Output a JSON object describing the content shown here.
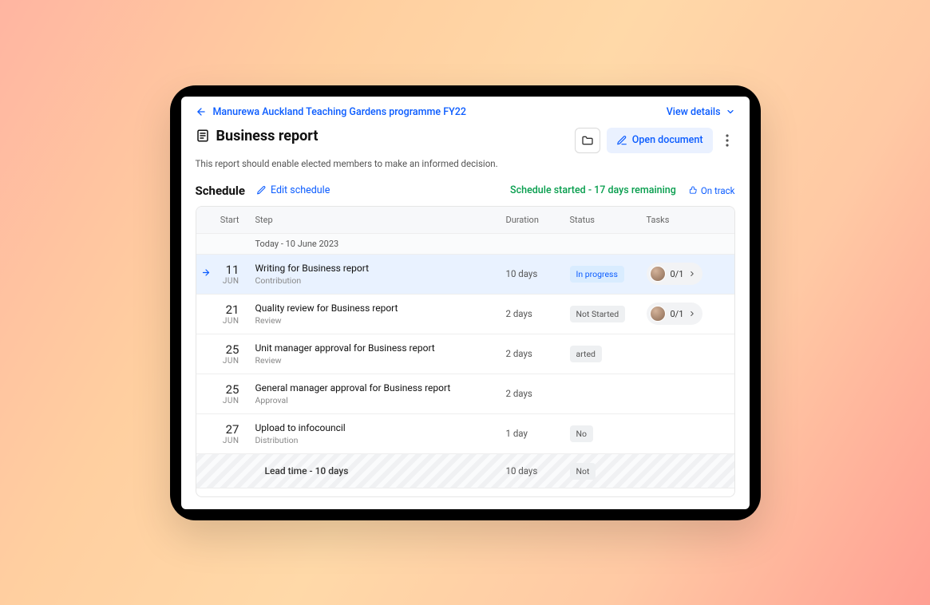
{
  "header": {
    "breadcrumb": "Manurewa Auckland Teaching Gardens programme FY22",
    "view_details": "View details"
  },
  "page": {
    "title": "Business report",
    "subtitle": "This report should enable elected members to make an informed decision.",
    "open_document": "Open document"
  },
  "schedule": {
    "title": "Schedule",
    "edit": "Edit schedule",
    "status_text": "Schedule started - 17 days remaining",
    "on_track": "On track"
  },
  "columns": {
    "start": "Start",
    "step": "Step",
    "duration": "Duration",
    "status": "Status",
    "tasks": "Tasks"
  },
  "today_row": "Today - 10 June 2023",
  "steps": [
    {
      "day": "11",
      "month": "JUN",
      "title": "Writing for Business report",
      "sub": "Contribution",
      "duration": "10 days",
      "status": "In progress",
      "status_kind": "inprogress",
      "tasks": "0/1",
      "active": true
    },
    {
      "day": "21",
      "month": "JUN",
      "title": "Quality review for Business report",
      "sub": "Review",
      "duration": "2 days",
      "status": "Not Started",
      "status_kind": "neutral",
      "tasks": "0/1",
      "active": false
    },
    {
      "day": "25",
      "month": "JUN",
      "title": "Unit manager approval for Business report",
      "sub": "Review",
      "duration": "2 days",
      "status": "arted",
      "status_kind": "neutral",
      "tasks": "",
      "active": false
    },
    {
      "day": "25",
      "month": "JUN",
      "title": "General manager approval for Business report",
      "sub": "Approval",
      "duration": "2 days",
      "status": "",
      "status_kind": "",
      "tasks": "",
      "active": false
    },
    {
      "day": "27",
      "month": "JUN",
      "title": "Upload to infocouncil",
      "sub": "Distribution",
      "duration": "1 day",
      "status": "No",
      "status_kind": "neutral",
      "tasks": "",
      "active": false
    }
  ],
  "lead_time": {
    "label": "Lead time - 10 days",
    "duration": "10 days",
    "status": "Not"
  }
}
